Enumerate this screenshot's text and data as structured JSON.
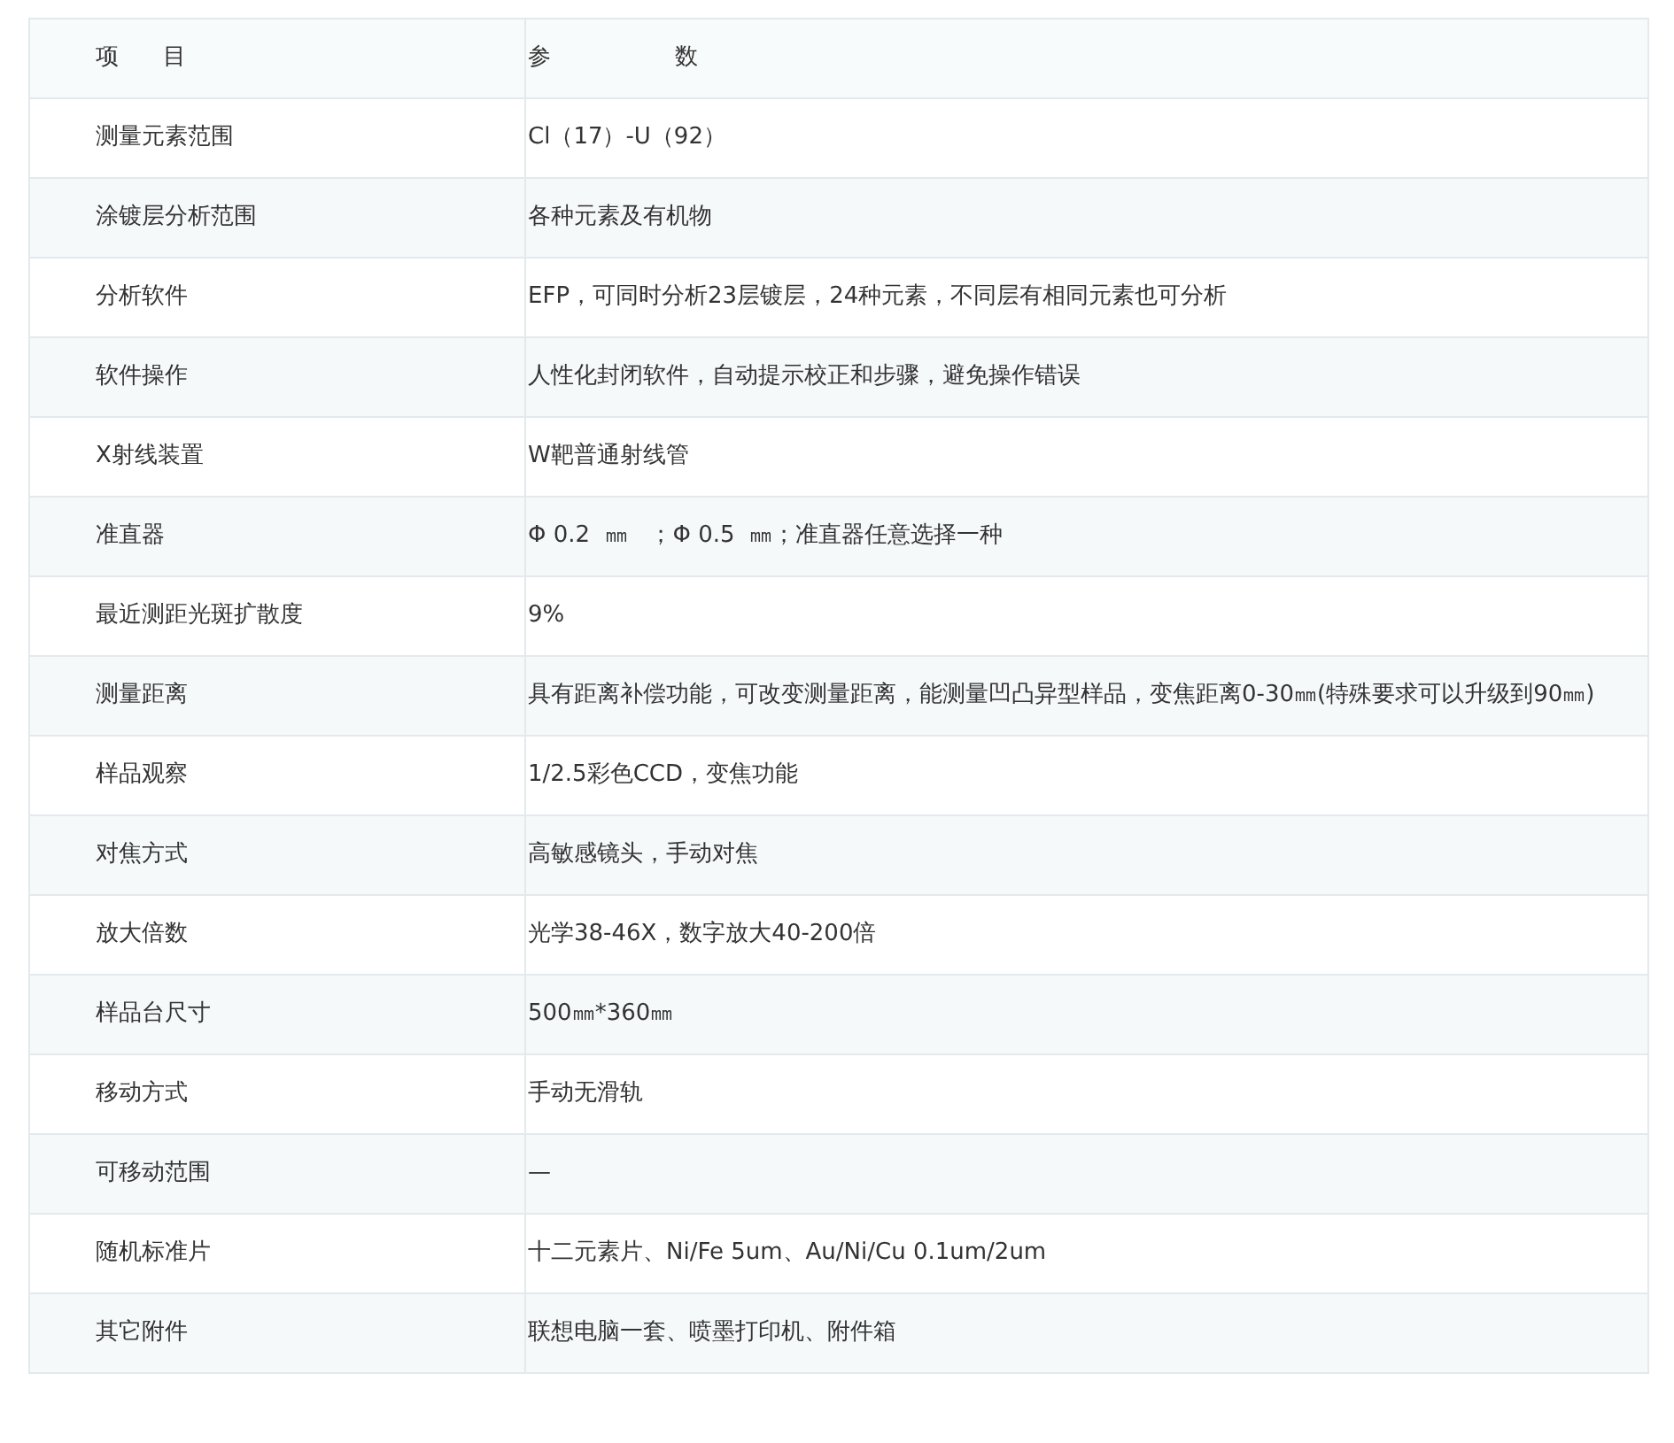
{
  "table": {
    "columns": [
      "项      目",
      "参                 数"
    ],
    "rows": [
      [
        "测量元素范围",
        "Cl（17）-U（92）"
      ],
      [
        "涂镀层分析范围",
        "各种元素及有机物"
      ],
      [
        "分析软件",
        "EFP，可同时分析23层镀层，24种元素，不同层有相同元素也可分析"
      ],
      [
        "软件操作",
        "人性化封闭软件，自动提示校正和步骤，避免操作错误"
      ],
      [
        "X射线装置",
        "W靶普通射线管"
      ],
      [
        "准直器",
        "Φ 0.2  ㎜   ；Φ 0.5  ㎜；准直器任意选择一种"
      ],
      [
        "最近测距光斑扩散度",
        "9%"
      ],
      [
        "测量距离",
        "具有距离补偿功能，可改变测量距离，能测量凹凸异型样品，变焦距离0-30㎜(特殊要求可以升级到90㎜)"
      ],
      [
        "样品观察",
        "1/2.5彩色CCD，变焦功能"
      ],
      [
        "对焦方式",
        "高敏感镜头，手动对焦"
      ],
      [
        "放大倍数",
        "光学38-46X，数字放大40-200倍"
      ],
      [
        "样品台尺寸",
        "500㎜*360㎜"
      ],
      [
        "移动方式",
        "手动无滑轨"
      ],
      [
        "可移动范围",
        "—"
      ],
      [
        "随机标准片",
        "十二元素片、Ni/Fe 5um、Au/Ni/Cu 0.1um/2um"
      ],
      [
        "其它附件",
        "联想电脑一套、喷墨打印机、附件箱"
      ]
    ]
  }
}
